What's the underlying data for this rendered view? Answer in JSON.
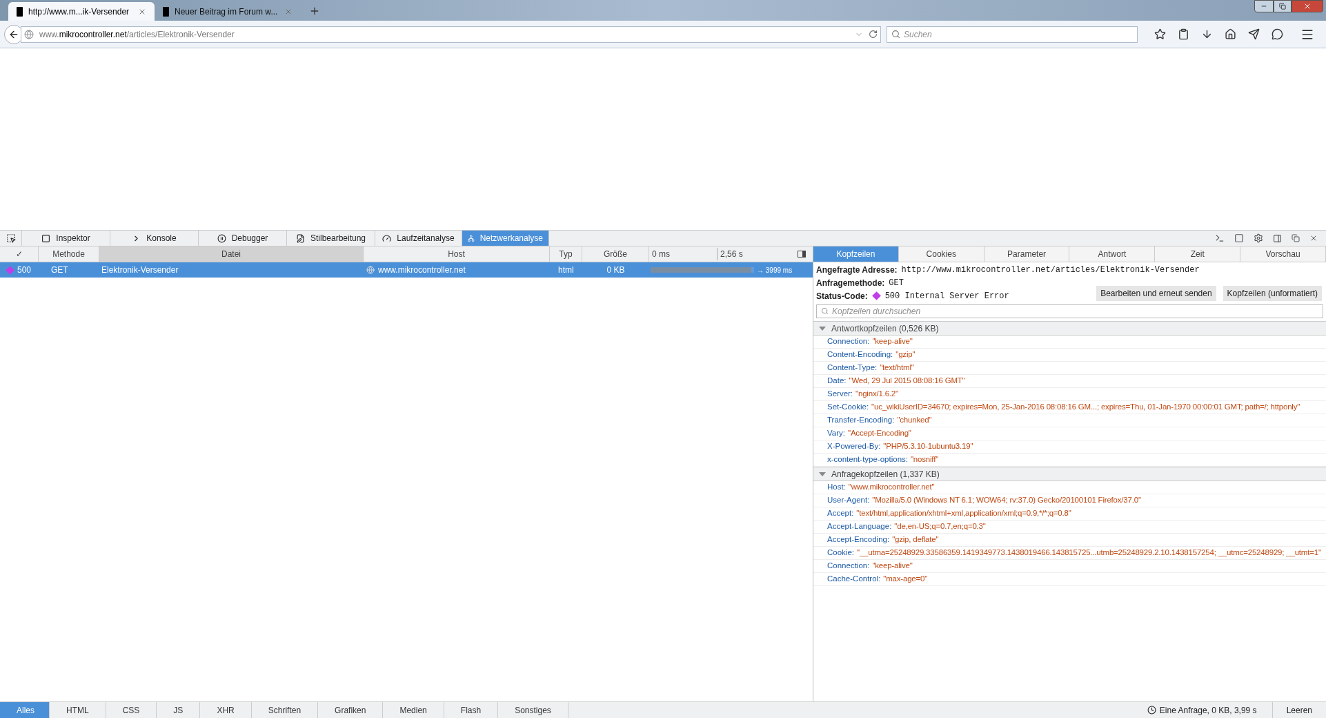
{
  "browser": {
    "tabs": [
      {
        "title": "http://www.m...ik-Versender",
        "selected": true
      },
      {
        "title": "Neuer Beitrag im Forum w...",
        "selected": false
      }
    ],
    "url": "www.**mikrocontroller.net**/articles/Elektronik-Versender",
    "search": {
      "placeholder": "Suchen"
    }
  },
  "devtools": {
    "tools": [
      {
        "label": "Inspektor",
        "selected": false
      },
      {
        "label": "Konsole",
        "selected": false
      },
      {
        "label": "Debugger",
        "selected": false
      },
      {
        "label": "Stilbearbeitung",
        "selected": false
      },
      {
        "label": "Laufzeitanalyse",
        "selected": false
      },
      {
        "label": "Netzwerkanalyse",
        "selected": true
      }
    ],
    "table": {
      "columns": [
        {
          "label": "✓",
          "sorted": false
        },
        {
          "label": "Methode",
          "sorted": false
        },
        {
          "label": "Datei",
          "sorted": true
        },
        {
          "label": "Host",
          "sorted": false
        },
        {
          "label": "Typ",
          "sorted": false
        },
        {
          "label": "Größe",
          "sorted": false
        }
      ],
      "timeline_ticks": [
        "0 ms",
        "2,56 s"
      ],
      "rows": [
        {
          "status": "500",
          "color": "#c03ee8",
          "method": "GET",
          "file": "Elektronik-Versender",
          "host": "www.mikrocontroller.net",
          "type": "html",
          "size": "0 KB",
          "level": 0.97,
          "duration": "→ 3999 ms",
          "selected": true
        }
      ]
    },
    "details": {
      "tabs": [
        {
          "label": "Kopfzeilen",
          "selected": true
        },
        {
          "label": "Cookies",
          "selected": false
        },
        {
          "label": "Parameter",
          "selected": false
        },
        {
          "label": "Antwort",
          "selected": false
        },
        {
          "label": "Zeit",
          "selected": false
        },
        {
          "label": "Vorschau",
          "selected": false
        }
      ],
      "summary": [
        {
          "label": "Angefragte Adresse:",
          "value": "http://www.mikrocontroller.net/articles/Elektronik-Versender"
        },
        {
          "label": "Anfragemethode:",
          "value": "GET"
        },
        {
          "label": "Status-Code:",
          "value": "500 Internal Server Error",
          "color": "#c03ee8"
        }
      ],
      "buttons": [
        "Bearbeiten und erneut senden",
        "Kopfzeilen (unformatiert)"
      ],
      "filter": {
        "placeholder": "Kopfzeilen durchsuchen"
      },
      "groups": [
        {
          "title": "Antwortkopfzeilen (0,526 KB)",
          "expanded": true,
          "headers": [
            {
              "name": "Connection:",
              "value": "\"keep-alive\""
            },
            {
              "name": "Content-Encoding:",
              "value": "\"gzip\""
            },
            {
              "name": "Content-Type:",
              "value": "\"text/html\""
            },
            {
              "name": "Date:",
              "value": "\"Wed, 29 Jul 2015 08:08:16 GMT\""
            },
            {
              "name": "Server:",
              "value": "\"nginx/1.6.2\""
            },
            {
              "name": "Set-Cookie:",
              "value": "\"uc_wikiUserID=34670; expires=Mon, 25-Jan-2016 08:08:16 GM...; expires=Thu, 01-Jan-1970 00:00:01 GMT; path=/; httponly\""
            },
            {
              "name": "Transfer-Encoding:",
              "value": "\"chunked\""
            },
            {
              "name": "Vary:",
              "value": "\"Accept-Encoding\""
            },
            {
              "name": "X-Powered-By:",
              "value": "\"PHP/5.3.10-1ubuntu3.19\""
            },
            {
              "name": "x-content-type-options:",
              "value": "\"nosniff\""
            }
          ]
        },
        {
          "title": "Anfragekopfzeilen (1,337 KB)",
          "expanded": true,
          "headers": [
            {
              "name": "Host:",
              "value": "\"www.mikrocontroller.net\""
            },
            {
              "name": "User-Agent:",
              "value": "\"Mozilla/5.0 (Windows NT 6.1; WOW64; rv:37.0) Gecko/20100101 Firefox/37.0\""
            },
            {
              "name": "Accept:",
              "value": "\"text/html,application/xhtml+xml,application/xml;q=0.9,*/*;q=0.8\""
            },
            {
              "name": "Accept-Language:",
              "value": "\"de,en-US;q=0.7,en;q=0.3\""
            },
            {
              "name": "Accept-Encoding:",
              "value": "\"gzip, deflate\""
            },
            {
              "name": "Cookie:",
              "value": "\"__utma=25248929.33586359.1419349773.1438019466.143815725...utmb=25248929.2.10.1438157254; __utmc=25248929; __utmt=1\""
            },
            {
              "name": "Connection:",
              "value": "\"keep-alive\""
            },
            {
              "name": "Cache-Control:",
              "value": "\"max-age=0\""
            }
          ]
        }
      ]
    },
    "filters": [
      {
        "label": "Alles",
        "selected": true
      },
      {
        "label": "HTML",
        "selected": false
      },
      {
        "label": "CSS",
        "selected": false
      },
      {
        "label": "JS",
        "selected": false
      },
      {
        "label": "XHR",
        "selected": false
      },
      {
        "label": "Schriften",
        "selected": false
      },
      {
        "label": "Grafiken",
        "selected": false
      },
      {
        "label": "Medien",
        "selected": false
      },
      {
        "label": "Flash",
        "selected": false
      },
      {
        "label": "Sonstiges",
        "selected": false
      }
    ],
    "summary": "Eine Anfrage, 0 KB, 3,99 s",
    "clear_button": "Leeren"
  }
}
